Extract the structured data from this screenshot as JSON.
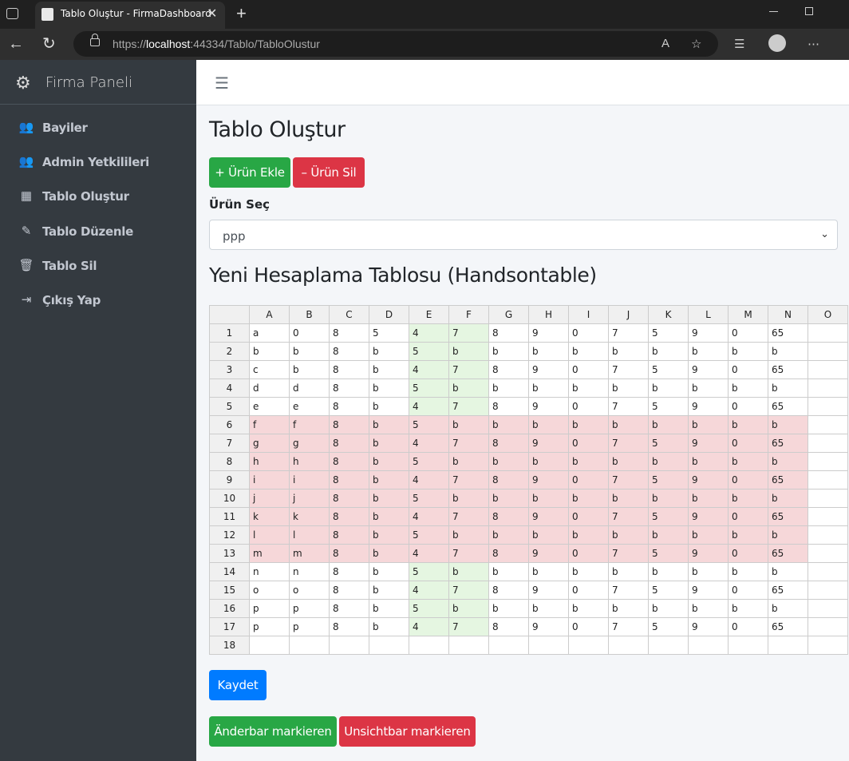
{
  "browser": {
    "tab_title": "Tablo Oluştur - FirmaDashboard",
    "url_prefix": "https://",
    "url_host": "localhost",
    "url_rest": ":44334/Tablo/TabloOlustur"
  },
  "sidebar": {
    "brand": "Firma Paneli",
    "items": [
      {
        "label": "Bayiler",
        "icon": "users-icon"
      },
      {
        "label": "Admin Yetkilileri",
        "icon": "users-icon"
      },
      {
        "label": "Tablo Oluştur",
        "icon": "table-icon"
      },
      {
        "label": "Tablo Düzenle",
        "icon": "edit-icon"
      },
      {
        "label": "Tablo Sil",
        "icon": "trash-icon"
      },
      {
        "label": "Çıkış Yap",
        "icon": "sign-out-icon"
      }
    ]
  },
  "main": {
    "title": "Tablo Oluştur",
    "add_button": "+ Ürün Ekle",
    "remove_button": "– Ürün Sil",
    "select_label": "Ürün Seç",
    "select_value": "ppp",
    "section_title": "Yeni Hesaplama Tablosu (Handsontable)",
    "save_button": "Kaydet",
    "mark_visible_button": "Änderbar markieren",
    "mark_invisible_button": "Unsichtbar markieren"
  },
  "grid": {
    "columns": [
      "A",
      "B",
      "C",
      "D",
      "E",
      "F",
      "G",
      "H",
      "I",
      "J",
      "K",
      "L",
      "M",
      "N",
      "O"
    ],
    "rows": [
      {
        "n": "1",
        "red": false,
        "cells": [
          "a",
          "0",
          "8",
          "5",
          "4",
          "7",
          "8",
          "9",
          "0",
          "7",
          "5",
          "9",
          "0",
          "65",
          ""
        ]
      },
      {
        "n": "2",
        "red": false,
        "cells": [
          "b",
          "b",
          "8",
          "b",
          "5",
          "b",
          "b",
          "b",
          "b",
          "b",
          "b",
          "b",
          "b",
          "b",
          ""
        ]
      },
      {
        "n": "3",
        "red": false,
        "cells": [
          "c",
          "b",
          "8",
          "b",
          "4",
          "7",
          "8",
          "9",
          "0",
          "7",
          "5",
          "9",
          "0",
          "65",
          ""
        ]
      },
      {
        "n": "4",
        "red": false,
        "cells": [
          "d",
          "d",
          "8",
          "b",
          "5",
          "b",
          "b",
          "b",
          "b",
          "b",
          "b",
          "b",
          "b",
          "b",
          ""
        ]
      },
      {
        "n": "5",
        "red": false,
        "cells": [
          "e",
          "e",
          "8",
          "b",
          "4",
          "7",
          "8",
          "9",
          "0",
          "7",
          "5",
          "9",
          "0",
          "65",
          ""
        ]
      },
      {
        "n": "6",
        "red": true,
        "cells": [
          "f",
          "f",
          "8",
          "b",
          "5",
          "b",
          "b",
          "b",
          "b",
          "b",
          "b",
          "b",
          "b",
          "b",
          ""
        ]
      },
      {
        "n": "7",
        "red": true,
        "cells": [
          "g",
          "g",
          "8",
          "b",
          "4",
          "7",
          "8",
          "9",
          "0",
          "7",
          "5",
          "9",
          "0",
          "65",
          ""
        ]
      },
      {
        "n": "8",
        "red": true,
        "cells": [
          "h",
          "h",
          "8",
          "b",
          "5",
          "b",
          "b",
          "b",
          "b",
          "b",
          "b",
          "b",
          "b",
          "b",
          ""
        ]
      },
      {
        "n": "9",
        "red": true,
        "cells": [
          "i",
          "i",
          "8",
          "b",
          "4",
          "7",
          "8",
          "9",
          "0",
          "7",
          "5",
          "9",
          "0",
          "65",
          ""
        ]
      },
      {
        "n": "10",
        "red": true,
        "cells": [
          "j",
          "j",
          "8",
          "b",
          "5",
          "b",
          "b",
          "b",
          "b",
          "b",
          "b",
          "b",
          "b",
          "b",
          ""
        ]
      },
      {
        "n": "11",
        "red": true,
        "cells": [
          "k",
          "k",
          "8",
          "b",
          "4",
          "7",
          "8",
          "9",
          "0",
          "7",
          "5",
          "9",
          "0",
          "65",
          ""
        ]
      },
      {
        "n": "12",
        "red": true,
        "cells": [
          "l",
          "l",
          "8",
          "b",
          "5",
          "b",
          "b",
          "b",
          "b",
          "b",
          "b",
          "b",
          "b",
          "b",
          ""
        ]
      },
      {
        "n": "13",
        "red": true,
        "cells": [
          "m",
          "m",
          "8",
          "b",
          "4",
          "7",
          "8",
          "9",
          "0",
          "7",
          "5",
          "9",
          "0",
          "65",
          ""
        ]
      },
      {
        "n": "14",
        "red": false,
        "cells": [
          "n",
          "n",
          "8",
          "b",
          "5",
          "b",
          "b",
          "b",
          "b",
          "b",
          "b",
          "b",
          "b",
          "b",
          ""
        ]
      },
      {
        "n": "15",
        "red": false,
        "cells": [
          "o",
          "o",
          "8",
          "b",
          "4",
          "7",
          "8",
          "9",
          "0",
          "7",
          "5",
          "9",
          "0",
          "65",
          ""
        ]
      },
      {
        "n": "16",
        "red": false,
        "cells": [
          "p",
          "p",
          "8",
          "b",
          "5",
          "b",
          "b",
          "b",
          "b",
          "b",
          "b",
          "b",
          "b",
          "b",
          ""
        ]
      },
      {
        "n": "17",
        "red": false,
        "cells": [
          "p",
          "p",
          "8",
          "b",
          "4",
          "7",
          "8",
          "9",
          "0",
          "7",
          "5",
          "9",
          "0",
          "65",
          ""
        ]
      },
      {
        "n": "18",
        "red": false,
        "cells": [
          "",
          "",
          "",
          "",
          "",
          "",
          "",
          "",
          "",
          "",
          "",
          "",
          "",
          "",
          ""
        ]
      }
    ],
    "green_columns": [
      4,
      5
    ],
    "colors": {
      "green": "#e5f6e1",
      "red": "#f6d7d9"
    }
  }
}
